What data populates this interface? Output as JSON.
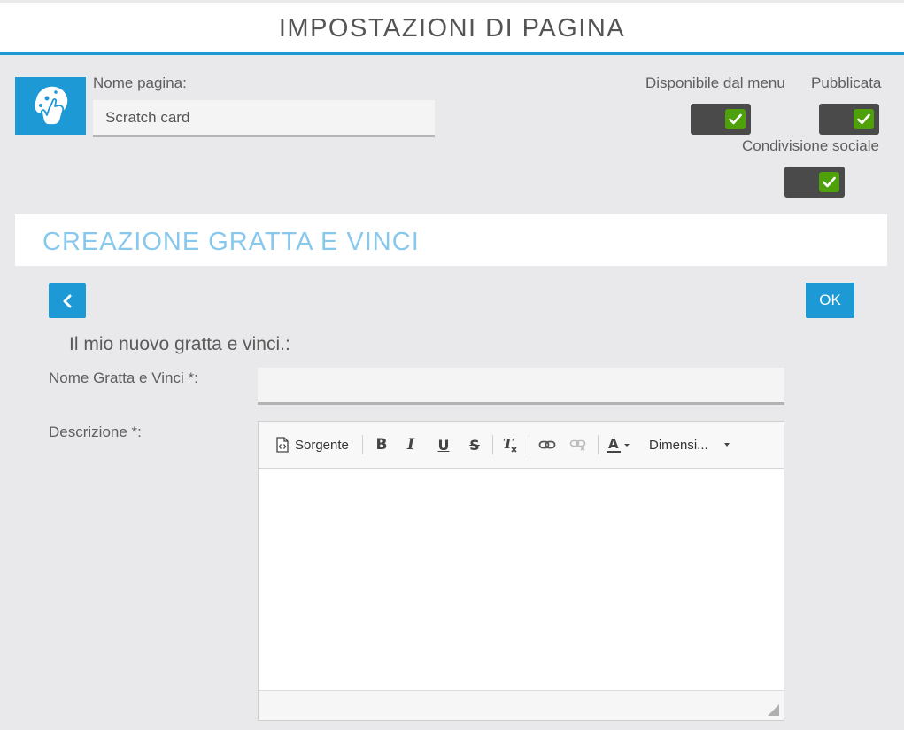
{
  "header": {
    "title": "IMPOSTAZIONI DI PAGINA"
  },
  "page": {
    "name_label": "Nome pagina:",
    "name_value": "Scratch card",
    "icon": "scratch-hand-icon"
  },
  "toggles": {
    "menu_label": "Disponibile dal menu",
    "menu_checked": true,
    "published_label": "Pubblicata",
    "published_checked": true,
    "social_label": "Condivisione sociale",
    "social_checked": true
  },
  "section": {
    "title": "CREAZIONE GRATTA E VINCI"
  },
  "actions": {
    "ok_label": "OK",
    "back_icon": "chevron-left-icon"
  },
  "form": {
    "subtitle": "Il mio nuovo gratta e vinci.:",
    "name_label": "Nome Gratta e Vinci *:",
    "name_value": "",
    "description_label": "Descrizione *:"
  },
  "editor": {
    "source_label": "Sorgente",
    "size_label": "Dimensi...",
    "content": ""
  },
  "colors": {
    "accent": "#1d9ad6",
    "toggle_on": "#4fa10a",
    "toggle_track": "#4a4a4a",
    "section_title": "#88c8ec"
  }
}
